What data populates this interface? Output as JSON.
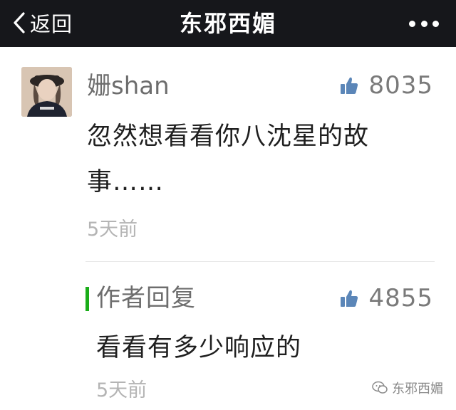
{
  "navbar": {
    "back_label": "返回",
    "title": "东邪西媚",
    "back_icon": "chevron-left-icon",
    "more_icon": "more-dots-icon"
  },
  "comment": {
    "nickname": "姗shan",
    "likes": "8035",
    "text": "忽然想看看你八沈星的故事……",
    "time": "5天前",
    "like_icon": "thumbs-up-icon"
  },
  "reply": {
    "label": "作者回复",
    "likes": "4855",
    "text": "看看有多少响应的",
    "time": "5天前",
    "accent_color": "#1aad19"
  },
  "watermark": {
    "text": "东邪西媚",
    "icon": "wechat-official-account-icon"
  },
  "colors": {
    "navbar_bg": "#16171b",
    "like_icon": "#5b86b8",
    "timestamp": "#b4b4b4"
  }
}
